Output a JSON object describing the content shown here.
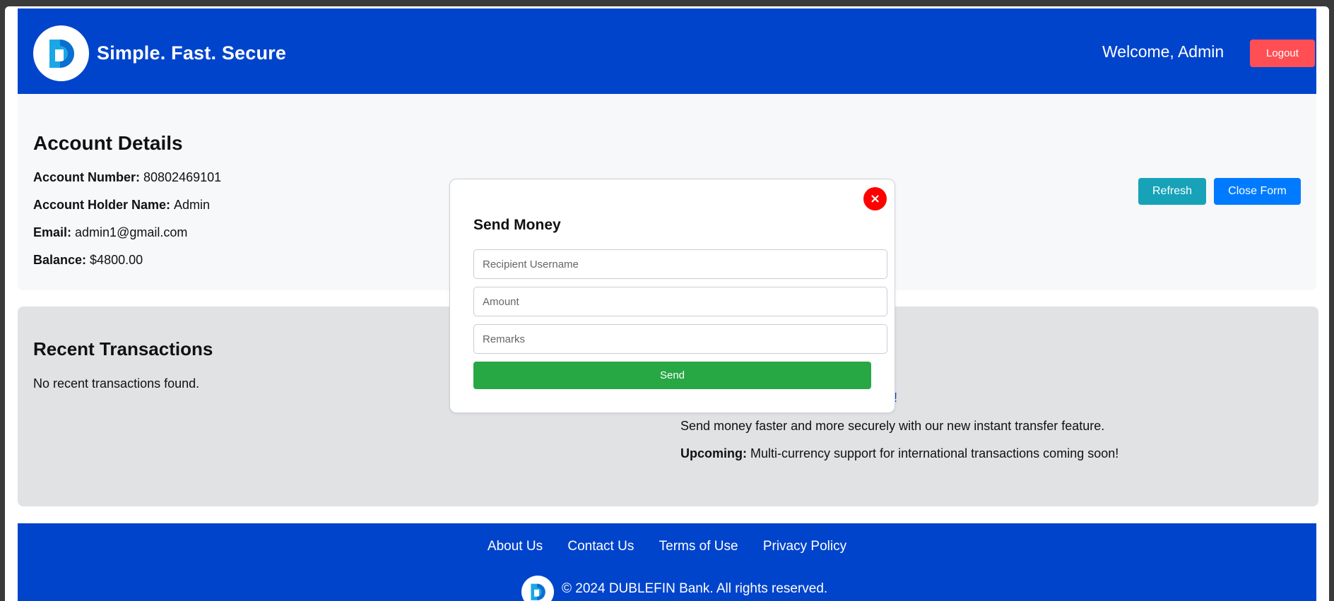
{
  "header": {
    "brand": "Simple. Fast. Secure",
    "welcome": "Welcome, Admin",
    "logout_label": "Logout",
    "logo_icon": "dublefin-logo-icon",
    "colors": {
      "header_bg": "#0044cc",
      "logout_bg": "#ff4f55"
    }
  },
  "account": {
    "title": "Account Details",
    "rows": [
      {
        "label": "Account Number:",
        "value": "80802469101"
      },
      {
        "label": "Account Holder Name:",
        "value": "Admin"
      },
      {
        "label": "Email:",
        "value": "admin1@gmail.com"
      },
      {
        "label": "Balance:",
        "value": "$4800.00"
      }
    ],
    "refresh_label": "Refresh",
    "close_form_label": "Close Form"
  },
  "transactions": {
    "title": "Recent Transactions",
    "empty_text": "No recent transactions found."
  },
  "news": {
    "link_fragment": "!",
    "line1": "Send money faster and more securely with our new instant transfer feature.",
    "line2_label": "Upcoming:",
    "line2_text": "Multi-currency support for international transactions coming soon!"
  },
  "modal": {
    "title": "Send Money",
    "close_icon": "close-icon",
    "close_glyph": "×",
    "recipient_placeholder": "Recipient Username",
    "amount_placeholder": "Amount",
    "remarks_placeholder": "Remarks",
    "send_label": "Send",
    "colors": {
      "send_bg": "#28a745",
      "close_bg": "#ff0000"
    }
  },
  "footer": {
    "links": [
      "About Us",
      "Contact Us",
      "Terms of Use",
      "Privacy Policy"
    ],
    "copyright": "© 2024 DUBLEFIN Bank. All rights reserved."
  }
}
